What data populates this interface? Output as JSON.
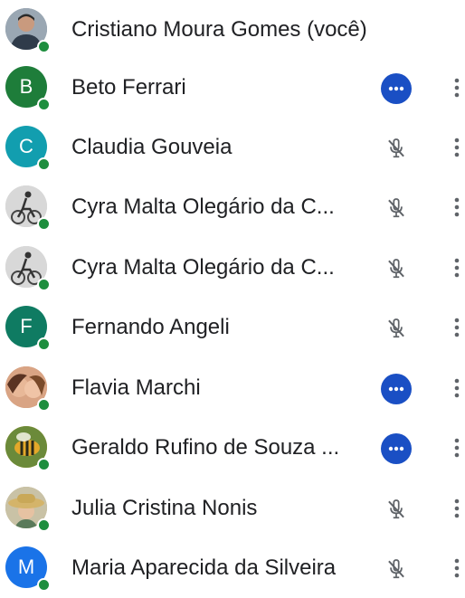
{
  "participants": [
    {
      "name": "Cristiano Moura Gomes (você)",
      "initial": "",
      "avatar_color": "#7a8a99",
      "avatar_type": "photo-person",
      "status": "none"
    },
    {
      "name": "Beto Ferrari",
      "initial": "B",
      "avatar_color": "#1e7d3a",
      "avatar_type": "letter",
      "status": "speaking"
    },
    {
      "name": "Claudia Gouveia",
      "initial": "C",
      "avatar_color": "#129eaf",
      "avatar_type": "letter",
      "status": "muted"
    },
    {
      "name": "Cyra Malta Olegário da C...",
      "initial": "",
      "avatar_color": "#cfcfcf",
      "avatar_type": "photo-cyclist",
      "status": "muted"
    },
    {
      "name": "Cyra Malta Olegário da C...",
      "initial": "",
      "avatar_color": "#cfcfcf",
      "avatar_type": "photo-cyclist",
      "status": "muted"
    },
    {
      "name": "Fernando Angeli",
      "initial": "F",
      "avatar_color": "#0f7b62",
      "avatar_type": "letter",
      "status": "muted"
    },
    {
      "name": "Flavia Marchi",
      "initial": "",
      "avatar_color": "#c98a6a",
      "avatar_type": "photo-faces",
      "status": "speaking"
    },
    {
      "name": "Geraldo Rufino de Souza ...",
      "initial": "",
      "avatar_color": "#e0b030",
      "avatar_type": "photo-bee",
      "status": "speaking"
    },
    {
      "name": "Julia Cristina Nonis",
      "initial": "",
      "avatar_color": "#b9a77a",
      "avatar_type": "photo-hat",
      "status": "muted"
    },
    {
      "name": "Maria Aparecida da Silveira",
      "initial": "M",
      "avatar_color": "#1a73e8",
      "avatar_type": "letter",
      "status": "muted"
    }
  ],
  "colors": {
    "online": "#1e8e3e",
    "speaking_bg": "#1a4fc4",
    "muted_icon": "#5f6368",
    "text": "#202124"
  },
  "icons": {
    "speaking": "more-horiz-icon",
    "muted": "mic-off-icon",
    "menu": "more-vert-icon"
  }
}
